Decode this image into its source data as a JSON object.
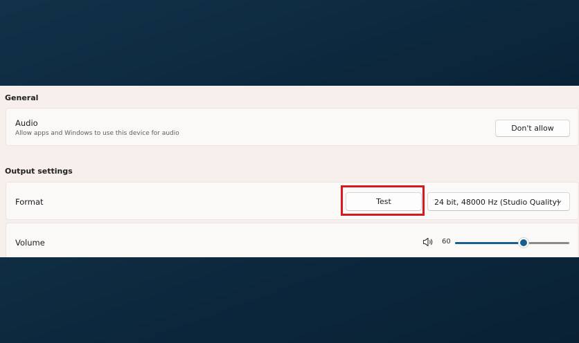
{
  "general": {
    "section_title": "General",
    "audio": {
      "title": "Audio",
      "description": "Allow apps and Windows to use this device for audio",
      "button_label": "Don't allow"
    }
  },
  "output_settings": {
    "section_title": "Output settings",
    "format": {
      "title": "Format",
      "test_button_label": "Test",
      "selected_format": "24 bit, 48000 Hz (Studio Quality)"
    },
    "volume": {
      "title": "Volume",
      "value_label": "60",
      "value": 60,
      "max": 100
    }
  },
  "colors": {
    "accent": "#1a5e8f",
    "highlight_box": "#d6181f",
    "panel_background": "#f6efec"
  },
  "icons": {
    "speaker": "speaker-icon",
    "chevron": "chevron-down-icon"
  }
}
